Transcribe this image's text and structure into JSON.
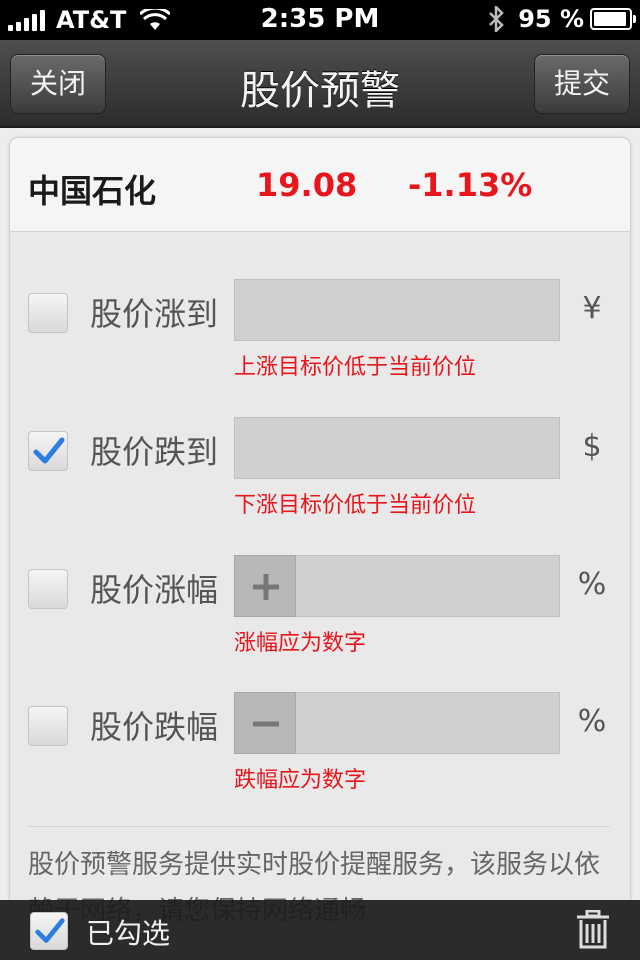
{
  "status_bar": {
    "carrier": "AT&T",
    "time": "2:35 PM",
    "battery": "95 %",
    "battery_level": 0.95
  },
  "nav": {
    "close_label": "关闭",
    "title": "股价预警",
    "submit_label": "提交"
  },
  "stock": {
    "name": "中国石化",
    "price": "19.08",
    "change": "-1.13%",
    "color": "#e8151b"
  },
  "alerts": [
    {
      "label": "股价涨到",
      "checked": false,
      "value": "",
      "unit": "¥",
      "hint": "上涨目标价低于当前价位"
    },
    {
      "label": "股价跌到",
      "checked": true,
      "value": "",
      "unit": "$",
      "hint": "下涨目标价低于当前价位"
    },
    {
      "label": "股价涨幅",
      "checked": false,
      "value": "",
      "unit": "%",
      "hint": "涨幅应为数字",
      "stepper_icon": "plus-icon"
    },
    {
      "label": "股价跌幅",
      "checked": false,
      "value": "",
      "unit": "%",
      "hint": "跌幅应为数字",
      "stepper_icon": "minus-icon"
    }
  ],
  "notice": "股价预警服务提供实时股价提醒服务，该服务以依赖于网络，请您保持网络通畅",
  "bottom_bar": {
    "select_all_label": "已勾选",
    "select_all_checked": true,
    "delete_icon": "trash-icon"
  },
  "colors": {
    "accent_check": "#2a7de1",
    "nav_background": "#3a3a3a",
    "hint_red": "#e8151b"
  }
}
